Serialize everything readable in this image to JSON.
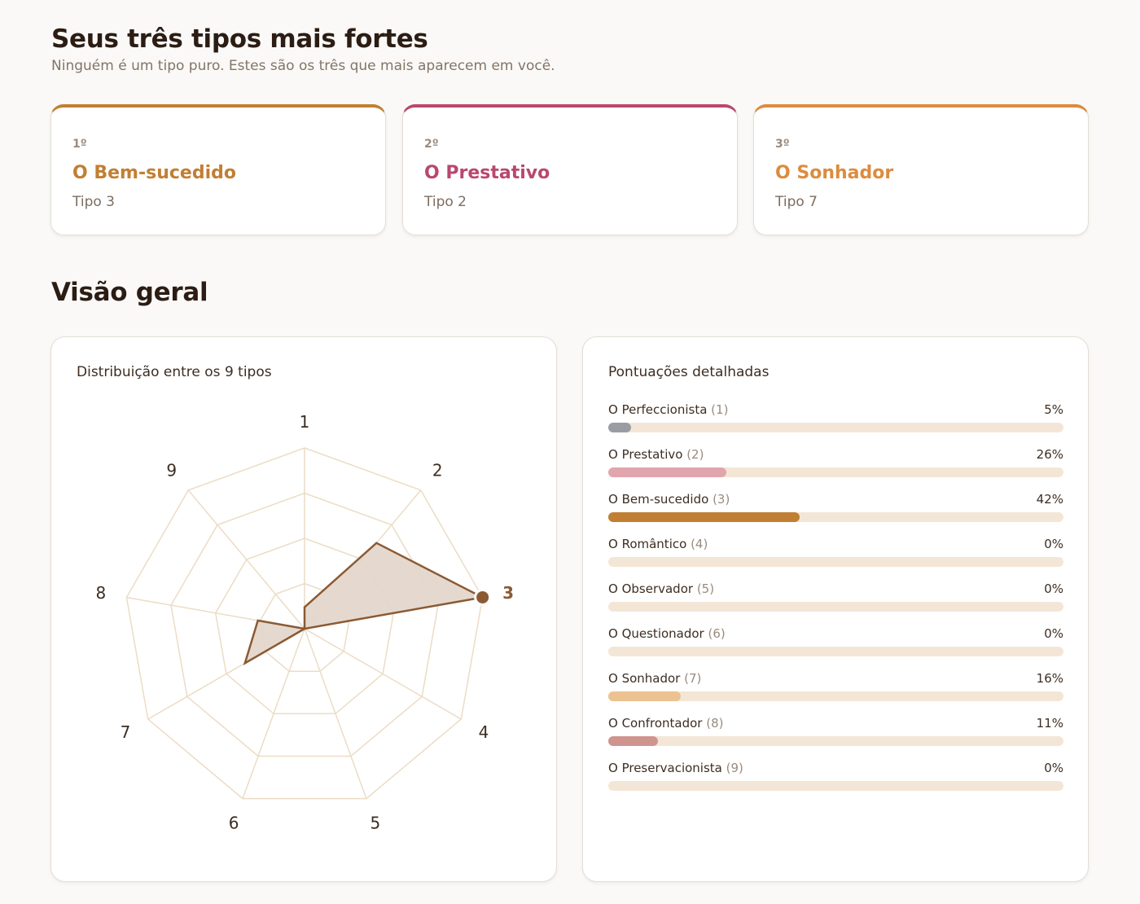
{
  "header": {
    "title": "Seus três tipos mais fortes",
    "subtitle": "Ninguém é um tipo puro. Estes são os três que mais aparecem em você."
  },
  "top_types": [
    {
      "rank": "1º",
      "name": "O Bem-sucedido",
      "type": "Tipo 3",
      "color": "#c17f33"
    },
    {
      "rank": "2º",
      "name": "O Prestativo",
      "type": "Tipo 2",
      "color": "#b9476f"
    },
    {
      "rank": "3º",
      "name": "O Sonhador",
      "type": "Tipo 7",
      "color": "#dc8c3e"
    }
  ],
  "overview": {
    "title": "Visão geral",
    "radar_title": "Distribuição entre os 9 tipos",
    "scores_title": "Pontuações detalhadas"
  },
  "chart_data": {
    "type": "radar",
    "axes": [
      "1",
      "2",
      "3",
      "4",
      "5",
      "6",
      "7",
      "8",
      "9"
    ],
    "values": [
      5,
      26,
      42,
      0,
      0,
      0,
      16,
      11,
      0
    ],
    "max": 42,
    "highlight_axis": "3",
    "grid_levels": 4,
    "line_color": "#8b5a33",
    "fill_color": "#e2d5ca",
    "grid_color": "#ecdcc5"
  },
  "scores": [
    {
      "name": "O Perfeccionista",
      "code": "(1)",
      "pct_label": "5%",
      "value": 5,
      "color": "#9b9ca3"
    },
    {
      "name": "O Prestativo",
      "code": "(2)",
      "pct_label": "26%",
      "value": 26,
      "color": "#e1a6ad"
    },
    {
      "name": "O Bem-sucedido",
      "code": "(3)",
      "pct_label": "42%",
      "value": 42,
      "color": "#c17f33"
    },
    {
      "name": "O Romântico",
      "code": "(4)",
      "pct_label": "0%",
      "value": 0,
      "color": "#d8b6c8"
    },
    {
      "name": "O Observador",
      "code": "(5)",
      "pct_label": "0%",
      "value": 0,
      "color": "#a7b6c8"
    },
    {
      "name": "O Questionador",
      "code": "(6)",
      "pct_label": "0%",
      "value": 0,
      "color": "#b9c7a3"
    },
    {
      "name": "O Sonhador",
      "code": "(7)",
      "pct_label": "16%",
      "value": 16,
      "color": "#ebc290"
    },
    {
      "name": "O Confrontador",
      "code": "(8)",
      "pct_label": "11%",
      "value": 11,
      "color": "#d0948f"
    },
    {
      "name": "O Preservacionista",
      "code": "(9)",
      "pct_label": "0%",
      "value": 0,
      "color": "#b4c3b8"
    }
  ]
}
